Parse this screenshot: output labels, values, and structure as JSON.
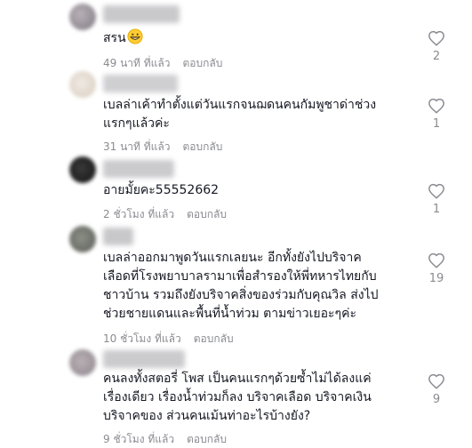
{
  "colors": {
    "text": "#161823",
    "meta": "#8a8b91",
    "emoji": "#ffcc33"
  },
  "comments": [
    {
      "text": "สรน",
      "emoji": "grinning-face-icon",
      "time": "49 นาที ที่แล้ว",
      "reply": "ตอบกลับ",
      "likes": "2"
    },
    {
      "text": "เบลล่าเค้าทำตั้งแต่วันแรกจนฌดนคนกัมพูชาด่าช่วง\nแรกๆแล้วค่ะ",
      "time": "31 นาที ที่แล้ว",
      "reply": "ตอบกลับ",
      "likes": "1"
    },
    {
      "text": "อายมั้ยคะ55552662",
      "time": "2 ชั่วโมง ที่แล้ว",
      "reply": "ตอบกลับ",
      "likes": "1"
    },
    {
      "text": "เบลล่าออกมาพูดวันแรกเลยนะ อีกทั้งยังไปบริจาค\nเลือดที่โรงพยาบาลรามาเพื่อสำรองให้พี่ทหารไทยกับ\nชาวบ้าน รวมถึงยังบริจาคสิ่งของร่วมกับคุณวิล ส่งไป\nช่วยชายแดนและพื้นที่น้ำท่วม ตามข่าวเยอะๆค่ะ",
      "time": "10 ชั่วโมง ที่แล้ว",
      "reply": "ตอบกลับ",
      "likes": "19"
    },
    {
      "text": "คนลงทั้งสตอรี่ โพส เป็นคนแรกๆด้วยซ้ำไม่ได้ลงแค่\nเรื่องเดียว เรื่องน้ำท่วมก็ลง บริจาคเลือด บริจาคเงิน\nบริจาคของ ส่วนคนเม้นท่าอะไรบ้างยัง?",
      "time": "9 ชั่วโมง ที่แล้ว",
      "reply": "ตอบกลับ",
      "likes": "9"
    }
  ]
}
